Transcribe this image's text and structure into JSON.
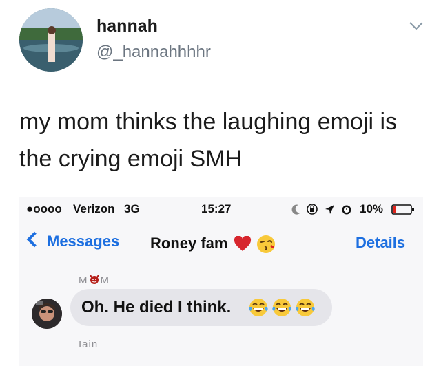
{
  "tweet": {
    "display_name": "hannah",
    "handle": "@_hannahhhhr",
    "text": "my mom thinks the laughing emoji is the crying emoji SMH"
  },
  "phone": {
    "status_bar": {
      "signal": "●oooo",
      "carrier": "Verizon",
      "network": "3G",
      "time": "15:27",
      "battery_percent": "10%",
      "status_icons": [
        "moon-icon",
        "rotation-lock-icon",
        "location-arrow-icon",
        "alarm-icon"
      ]
    },
    "nav": {
      "back_label": "Messages",
      "title": "Roney fam",
      "title_icons": [
        "heart-icon",
        "kissing-face-icon"
      ],
      "details_label": "Details"
    },
    "messages": [
      {
        "sender_prefix": "M",
        "sender_suffix": "M",
        "sender_icon": "devil-face-icon",
        "text": "Oh. He died I think.",
        "emojis": [
          "face-with-tears-of-joy-icon",
          "face-with-tears-of-joy-icon",
          "face-with-tears-of-joy-icon"
        ]
      }
    ],
    "next_sender": "Iain"
  },
  "colors": {
    "ios_blue": "#1d6fe0",
    "bubble_gray": "#e5e5ea",
    "handle_gray": "#6b7580"
  }
}
